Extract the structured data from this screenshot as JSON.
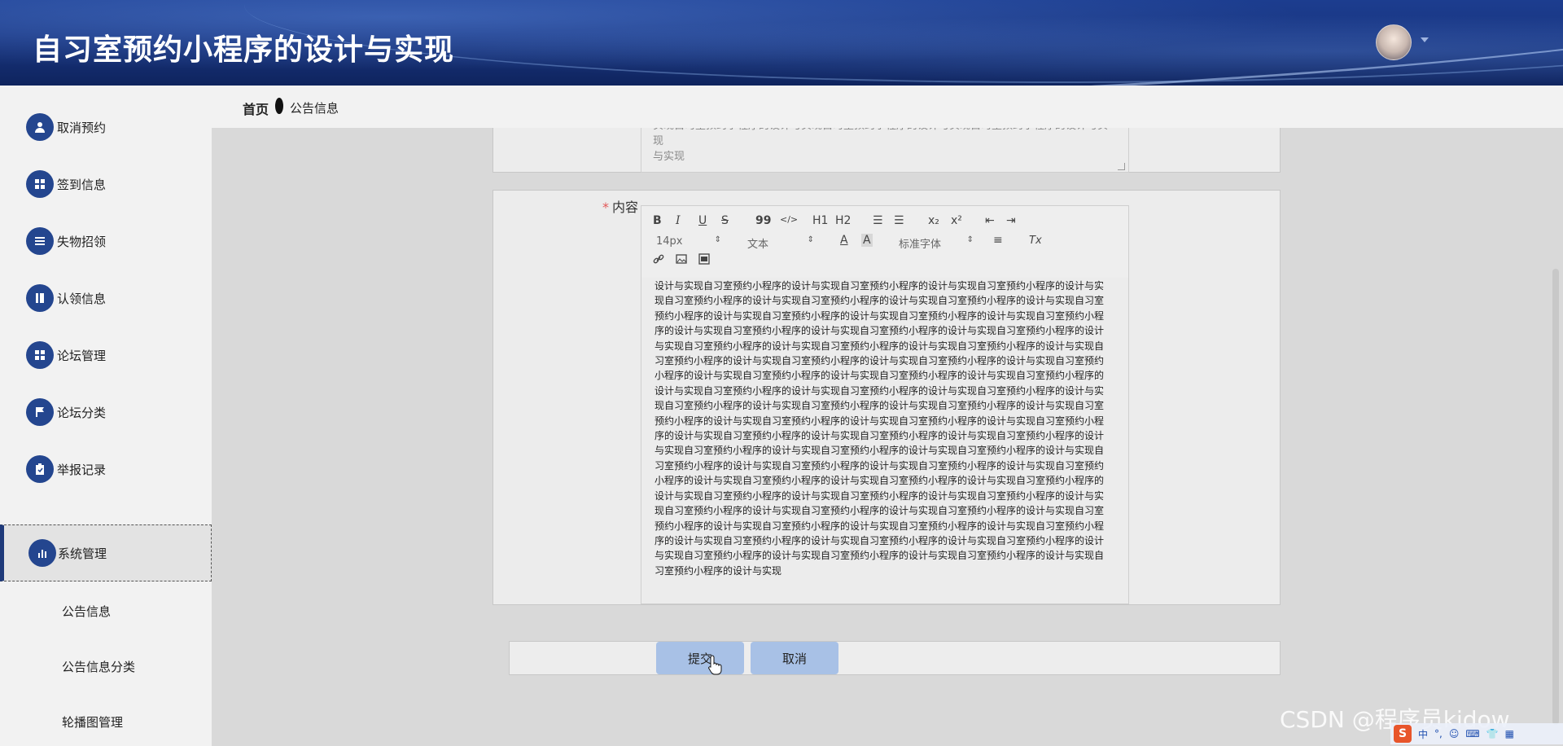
{
  "app": {
    "title": "自习室预约小程序的设计与实现"
  },
  "sidebar": {
    "items": [
      {
        "label": "取消预约",
        "icon": "user-icon"
      },
      {
        "label": "签到信息",
        "icon": "grid-icon"
      },
      {
        "label": "失物招领",
        "icon": "list-icon"
      },
      {
        "label": "认领信息",
        "icon": "book-icon"
      },
      {
        "label": "论坛管理",
        "icon": "grid-icon"
      },
      {
        "label": "论坛分类",
        "icon": "flag-icon"
      },
      {
        "label": "举报记录",
        "icon": "clipboard-icon"
      },
      {
        "label": "系统管理",
        "icon": "bar-chart-icon",
        "active": true
      }
    ],
    "sub_items": [
      {
        "label": "公告信息"
      },
      {
        "label": "公告信息分类"
      },
      {
        "label": "轮播图管理"
      }
    ]
  },
  "breadcrumb": {
    "home": "首页",
    "current": "公告信息"
  },
  "form": {
    "textarea_text": "实现自习室预约小程序的设计与实现自习室预约小程序的设计与实现自习室预约小程序的设计与实现",
    "content_label": "内容",
    "required_mark": "*",
    "editor": {
      "toolbar": {
        "bold": "B",
        "italic": "I",
        "underline": "U",
        "strike": "S",
        "quote": "99",
        "code": "</>",
        "h1": "H1",
        "h2": "H2",
        "ordered_list": "☰",
        "bullet_list": "☰",
        "subscript": "x₂",
        "superscript": "x²",
        "outdent": "⇤",
        "indent": "⇥",
        "font_size": "14px",
        "block_type": "文本",
        "font_color": "A",
        "bg_color": "A",
        "font_family": "标准字体",
        "align": "≡",
        "clear_format": "Tx",
        "link": "🔗",
        "image": "▣",
        "video": "▦"
      },
      "content": "设计与实现自习室预约小程序的设计与实现自习室预约小程序的设计与实现自习室预约小程序的设计与实现自习室预约小程序的设计与实现自习室预约小程序的设计与实现自习室预约小程序的设计与实现自习室预约小程序的设计与实现自习室预约小程序的设计与实现自习室预约小程序的设计与实现自习室预约小程序的设计与实现自习室预约小程序的设计与实现自习室预约小程序的设计与实现自习室预约小程序的设计与实现自习室预约小程序的设计与实现自习室预约小程序的设计与实现自习室预约小程序的设计与实现自习室预约小程序的设计与实现自习室预约小程序的设计与实现自习室预约小程序的设计与实现自习室预约小程序的设计与实现自习室预约小程序的设计与实现自习室预约小程序的设计与实现自习室预约小程序的设计与实现自习室预约小程序的设计与实现自习室预约小程序的设计与实现自习室预约小程序的设计与实现自习室预约小程序的设计与实现自习室预约小程序的设计与实现自习室预约小程序的设计与实现自习室预约小程序的设计与实现自习室预约小程序的设计与实现自习室预约小程序的设计与实现自习室预约小程序的设计与实现自习室预约小程序的设计与实现自习室预约小程序的设计与实现自习室预约小程序的设计与实现自习室预约小程序的设计与实现自习室预约小程序的设计与实现自习室预约小程序的设计与实现自习室预约小程序的设计与实现自习室预约小程序的设计与实现自习室预约小程序的设计与实现自习室预约小程序的设计与实现自习室预约小程序的设计与实现自习室预约小程序的设计与实现自习室预约小程序的设计与实现自习室预约小程序的设计与实现自习室预约小程序的设计与实现自习室预约小程序的设计与实现自习室预约小程序的设计与实现自习室预约小程序的设计与实现自习室预约小程序的设计与实现自习室预约小程序的设计与实现自习室预约小程序的设计与实现自习室预约小程序的设计与实现自习室预约小程序的设计与实现自习室预约小程序的设计与实现自习室预约小程序的设计与实现自习室预约小程序的设计与实现自习室预约小程序的设计与实现自习室预约小程序的设计与实现自习室预约小程序的设计与实现自习室预约小程序的设计与实现"
    },
    "submit_label": "提交",
    "cancel_label": "取消"
  },
  "watermark": "CSDN @程序员kidow",
  "tray": {
    "s_logo": "S",
    "items": [
      "中",
      "°,",
      "☺",
      "⌨",
      "👕",
      "▦"
    ]
  },
  "colors": {
    "header": "#1c3d8f",
    "menu_icon_bg": "#24468f",
    "button": "#a8c1e6",
    "required": "#e25858"
  }
}
